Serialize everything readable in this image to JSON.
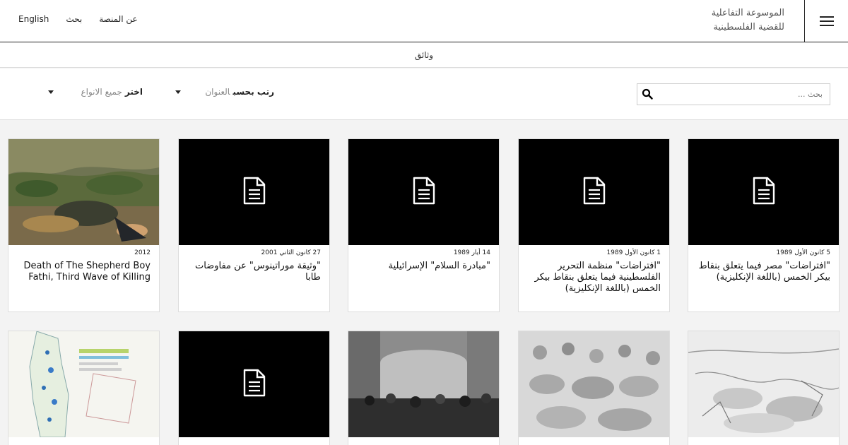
{
  "header": {
    "title_line1": "الموسوعة التفاعلية",
    "title_line2": "للقضية الفلسطينية",
    "links": [
      "English",
      "بحث",
      "عن المنصة"
    ]
  },
  "subheader": {
    "label": "وثائق"
  },
  "filters": {
    "search_placeholder": "بحث ...",
    "sort_strong": "رتب بحسب",
    "sort_value": "العنوان",
    "type_strong": "اختر",
    "type_value": "جميع الانواع"
  },
  "cards": [
    {
      "date": "5 كانون الأول 1989",
      "title": "\"افتراضات\" مصر فيما يتعلق بنقاط بيكر الخمس (باللغة الإنكليزية)",
      "thumb": "document"
    },
    {
      "date": "1 كانون الأول 1989",
      "title": "\"افتراضات\" منظمة التحرير الفلسطينية فيما يتعلق بنقاط بيكر الخمس (باللغة الإنكليزية)",
      "thumb": "document"
    },
    {
      "date": "14 أيار 1989",
      "title": "\"مبادرة السلام\" الإسرائيلية",
      "thumb": "document"
    },
    {
      "date": "27 كانون الثاني 2001",
      "title": "\"وثيقة موراتينوس\" عن مفاوضات طابا",
      "thumb": "document"
    },
    {
      "date": "2012",
      "title": "Death of The Shepherd Boy Fathi, Third Wave of Killing",
      "thumb": "painting"
    }
  ],
  "row2": [
    {
      "thumb": "sketch"
    },
    {
      "thumb": "sketch-crowd"
    },
    {
      "thumb": "photo"
    },
    {
      "thumb": "document"
    },
    {
      "thumb": "map"
    }
  ]
}
